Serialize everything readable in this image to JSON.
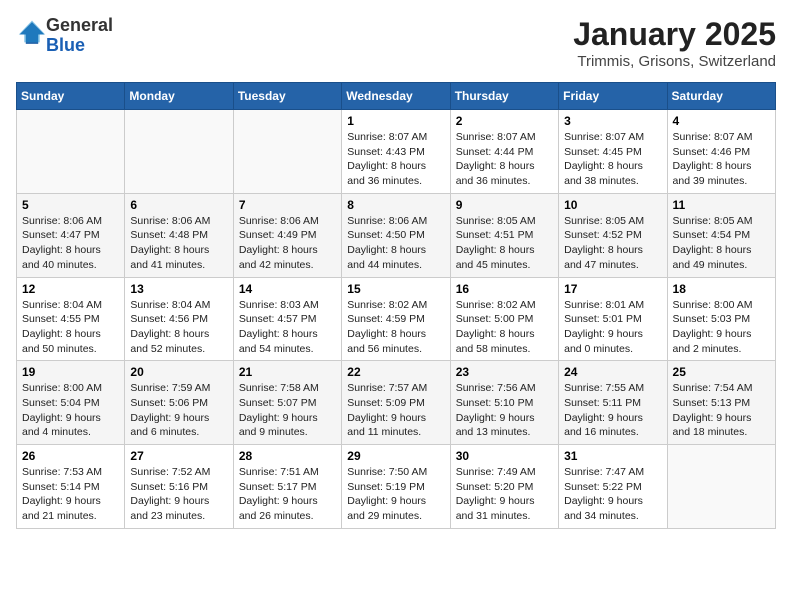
{
  "header": {
    "logo_line1": "General",
    "logo_line2": "Blue",
    "month": "January 2025",
    "location": "Trimmis, Grisons, Switzerland"
  },
  "weekdays": [
    "Sunday",
    "Monday",
    "Tuesday",
    "Wednesday",
    "Thursday",
    "Friday",
    "Saturday"
  ],
  "weeks": [
    [
      {
        "day": "",
        "info": ""
      },
      {
        "day": "",
        "info": ""
      },
      {
        "day": "",
        "info": ""
      },
      {
        "day": "1",
        "info": "Sunrise: 8:07 AM\nSunset: 4:43 PM\nDaylight: 8 hours\nand 36 minutes."
      },
      {
        "day": "2",
        "info": "Sunrise: 8:07 AM\nSunset: 4:44 PM\nDaylight: 8 hours\nand 36 minutes."
      },
      {
        "day": "3",
        "info": "Sunrise: 8:07 AM\nSunset: 4:45 PM\nDaylight: 8 hours\nand 38 minutes."
      },
      {
        "day": "4",
        "info": "Sunrise: 8:07 AM\nSunset: 4:46 PM\nDaylight: 8 hours\nand 39 minutes."
      }
    ],
    [
      {
        "day": "5",
        "info": "Sunrise: 8:06 AM\nSunset: 4:47 PM\nDaylight: 8 hours\nand 40 minutes."
      },
      {
        "day": "6",
        "info": "Sunrise: 8:06 AM\nSunset: 4:48 PM\nDaylight: 8 hours\nand 41 minutes."
      },
      {
        "day": "7",
        "info": "Sunrise: 8:06 AM\nSunset: 4:49 PM\nDaylight: 8 hours\nand 42 minutes."
      },
      {
        "day": "8",
        "info": "Sunrise: 8:06 AM\nSunset: 4:50 PM\nDaylight: 8 hours\nand 44 minutes."
      },
      {
        "day": "9",
        "info": "Sunrise: 8:05 AM\nSunset: 4:51 PM\nDaylight: 8 hours\nand 45 minutes."
      },
      {
        "day": "10",
        "info": "Sunrise: 8:05 AM\nSunset: 4:52 PM\nDaylight: 8 hours\nand 47 minutes."
      },
      {
        "day": "11",
        "info": "Sunrise: 8:05 AM\nSunset: 4:54 PM\nDaylight: 8 hours\nand 49 minutes."
      }
    ],
    [
      {
        "day": "12",
        "info": "Sunrise: 8:04 AM\nSunset: 4:55 PM\nDaylight: 8 hours\nand 50 minutes."
      },
      {
        "day": "13",
        "info": "Sunrise: 8:04 AM\nSunset: 4:56 PM\nDaylight: 8 hours\nand 52 minutes."
      },
      {
        "day": "14",
        "info": "Sunrise: 8:03 AM\nSunset: 4:57 PM\nDaylight: 8 hours\nand 54 minutes."
      },
      {
        "day": "15",
        "info": "Sunrise: 8:02 AM\nSunset: 4:59 PM\nDaylight: 8 hours\nand 56 minutes."
      },
      {
        "day": "16",
        "info": "Sunrise: 8:02 AM\nSunset: 5:00 PM\nDaylight: 8 hours\nand 58 minutes."
      },
      {
        "day": "17",
        "info": "Sunrise: 8:01 AM\nSunset: 5:01 PM\nDaylight: 9 hours\nand 0 minutes."
      },
      {
        "day": "18",
        "info": "Sunrise: 8:00 AM\nSunset: 5:03 PM\nDaylight: 9 hours\nand 2 minutes."
      }
    ],
    [
      {
        "day": "19",
        "info": "Sunrise: 8:00 AM\nSunset: 5:04 PM\nDaylight: 9 hours\nand 4 minutes."
      },
      {
        "day": "20",
        "info": "Sunrise: 7:59 AM\nSunset: 5:06 PM\nDaylight: 9 hours\nand 6 minutes."
      },
      {
        "day": "21",
        "info": "Sunrise: 7:58 AM\nSunset: 5:07 PM\nDaylight: 9 hours\nand 9 minutes."
      },
      {
        "day": "22",
        "info": "Sunrise: 7:57 AM\nSunset: 5:09 PM\nDaylight: 9 hours\nand 11 minutes."
      },
      {
        "day": "23",
        "info": "Sunrise: 7:56 AM\nSunset: 5:10 PM\nDaylight: 9 hours\nand 13 minutes."
      },
      {
        "day": "24",
        "info": "Sunrise: 7:55 AM\nSunset: 5:11 PM\nDaylight: 9 hours\nand 16 minutes."
      },
      {
        "day": "25",
        "info": "Sunrise: 7:54 AM\nSunset: 5:13 PM\nDaylight: 9 hours\nand 18 minutes."
      }
    ],
    [
      {
        "day": "26",
        "info": "Sunrise: 7:53 AM\nSunset: 5:14 PM\nDaylight: 9 hours\nand 21 minutes."
      },
      {
        "day": "27",
        "info": "Sunrise: 7:52 AM\nSunset: 5:16 PM\nDaylight: 9 hours\nand 23 minutes."
      },
      {
        "day": "28",
        "info": "Sunrise: 7:51 AM\nSunset: 5:17 PM\nDaylight: 9 hours\nand 26 minutes."
      },
      {
        "day": "29",
        "info": "Sunrise: 7:50 AM\nSunset: 5:19 PM\nDaylight: 9 hours\nand 29 minutes."
      },
      {
        "day": "30",
        "info": "Sunrise: 7:49 AM\nSunset: 5:20 PM\nDaylight: 9 hours\nand 31 minutes."
      },
      {
        "day": "31",
        "info": "Sunrise: 7:47 AM\nSunset: 5:22 PM\nDaylight: 9 hours\nand 34 minutes."
      },
      {
        "day": "",
        "info": ""
      }
    ]
  ]
}
